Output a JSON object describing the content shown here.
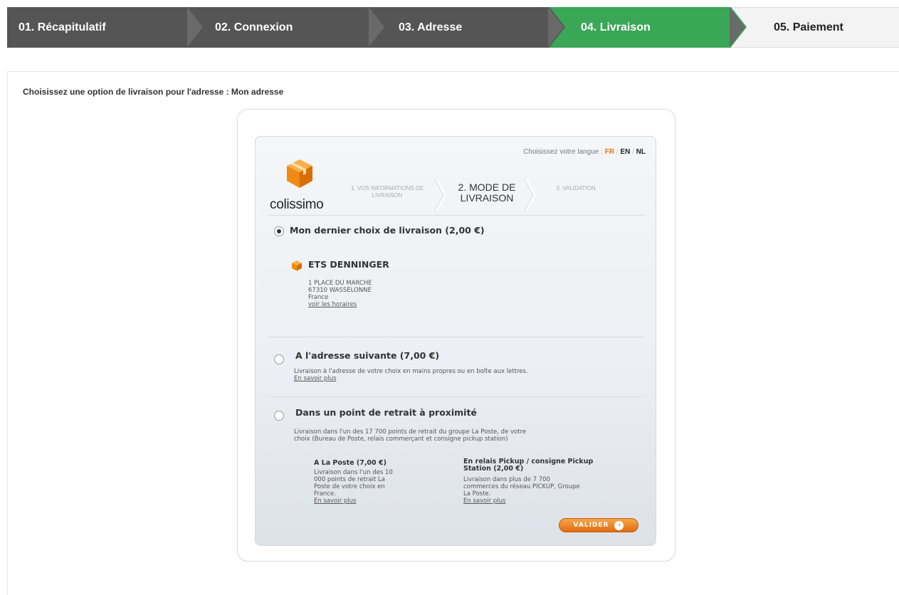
{
  "steps": [
    {
      "label": "01. Récapitulatif"
    },
    {
      "label": "02. Connexion"
    },
    {
      "label": "03. Adresse"
    },
    {
      "label": "04. Livraison"
    },
    {
      "label": "05. Paiement"
    }
  ],
  "instruction": "Choisissez une option de livraison pour l'adresse : Mon adresse",
  "widget": {
    "lang_label": "Choisissez votre langue :",
    "lang_fr": "FR",
    "lang_en": "EN",
    "lang_nl": "NL",
    "logo_text": "colissimo",
    "wsteps": [
      {
        "label": "1. VOS INFORMATIONS DE LIVRAISON"
      },
      {
        "label": "2. MODE DE LIVRAISON"
      },
      {
        "label": "3. VALIDATION"
      }
    ],
    "option1": {
      "title": "Mon dernier choix de livraison (2,00 €)",
      "selected": true,
      "relay_name": "ETS DENNINGER",
      "addr1": "1 PLACE DU MARCHE",
      "addr2": "67310 WASSELONNE",
      "country": "France",
      "hours_link": "voir les horaires"
    },
    "option2": {
      "title": "A l'adresse suivante (7,00 €)",
      "desc": "Livraison à l'adresse de votre choix en mains propres ou en boîte aux lettres.",
      "more": "En savoir plus"
    },
    "option3": {
      "title": "Dans un point de retrait à proximité",
      "desc1": "Livraison dans l'un des 17 700 points de retrait du groupe La Poste, de votre",
      "desc2": "choix (Bureau de Poste, relais commerçant et consigne pickup station)",
      "sub1": {
        "title": "A La Poste (7,00 €)",
        "l1": "Livraison dans l'un des 10",
        "l2": "000 points de retrait La",
        "l3": "Poste de votre choix en",
        "l4": "France.",
        "more": "En savoir plus"
      },
      "sub2": {
        "title1": "En relais Pickup / consigne Pickup",
        "title2": "Station (2,00 €)",
        "l1": "Livraison dans plus de 7 700",
        "l2": "commerces du réseau PICKUP, Groupe",
        "l3": "La Poste.",
        "more": "En savoir plus"
      }
    },
    "validate_label": "VALIDER"
  }
}
